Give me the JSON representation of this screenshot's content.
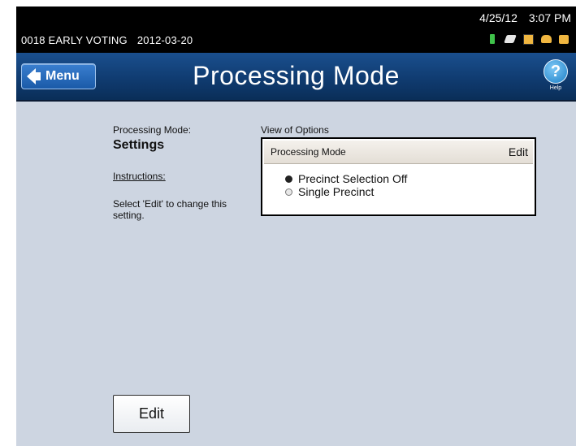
{
  "status": {
    "location": "0018 EARLY VOTING",
    "date": "2012-03-20",
    "current_date": "4/25/12",
    "current_time": "3:07 PM",
    "icons": [
      "battery-icon",
      "power-plug-icon",
      "memory-card-icon",
      "network-icon",
      "lock-icon"
    ]
  },
  "header": {
    "menu_label": "Menu",
    "title": "Processing Mode",
    "help_symbol": "?",
    "help_label": "Help"
  },
  "left": {
    "mode_label": "Processing Mode:",
    "mode_value": "Settings",
    "instructions_heading": "Instructions:",
    "instructions_text": "Select 'Edit' to change this setting."
  },
  "options": {
    "section_label": "View of Options",
    "header_label": "Processing Mode",
    "edit_label": "Edit",
    "items": [
      {
        "label": "Precinct Selection Off",
        "selected": true
      },
      {
        "label": "Single Precinct",
        "selected": false
      }
    ]
  },
  "footer": {
    "edit_button_label": "Edit"
  },
  "colors": {
    "background": "#cdd5e1",
    "title_bar": "#0f3a6e",
    "menu_button": "#2a6cc0",
    "help_button": "#1c7fc7"
  }
}
